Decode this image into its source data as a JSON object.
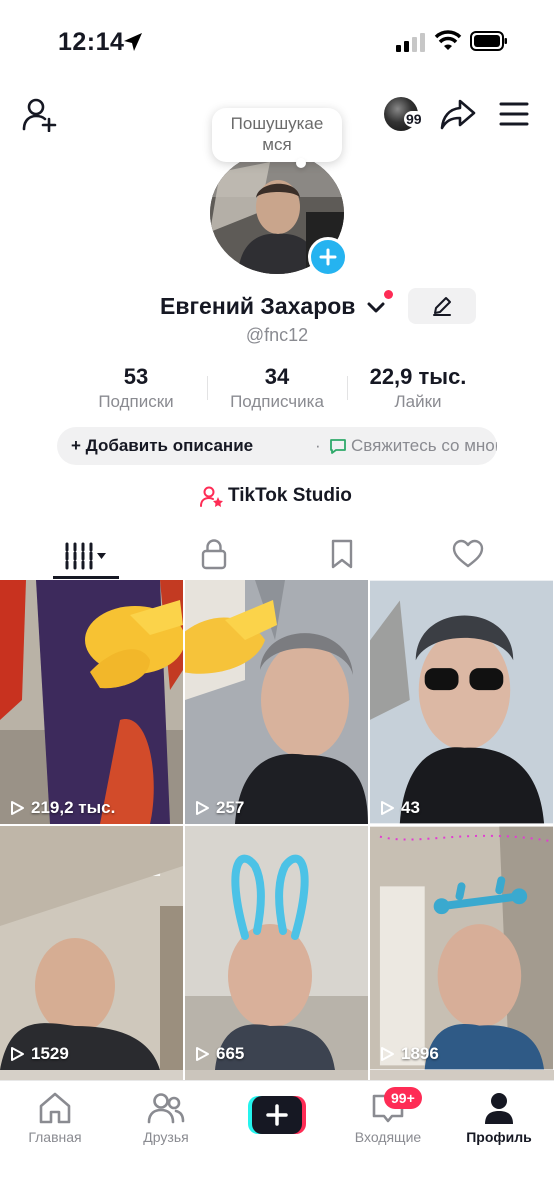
{
  "status_bar": {
    "time": "12:14"
  },
  "header": {
    "avatar_badge": "99",
    "icons": [
      "add-friend-icon",
      "share-icon",
      "menu-icon"
    ]
  },
  "profile": {
    "status_bubble": "Пошушукаемся",
    "status_bubble_line1": "Пошушукае",
    "status_bubble_line2": "мся",
    "display_name": "Евгений Захаров",
    "username": "@fnc12",
    "stats": [
      {
        "value": "53",
        "label": "Подписки"
      },
      {
        "value": "34",
        "label": "Подписчика"
      },
      {
        "value": "22,9 тыс.",
        "label": "Лайки"
      }
    ],
    "bio_add": "+ Добавить описание",
    "bio_separator": "·",
    "bio_contact": "Свяжитесь со мной…",
    "studio_label": "TikTok Studio"
  },
  "tabs": [
    "videos-tab",
    "private-tab",
    "saved-tab",
    "liked-tab"
  ],
  "videos": [
    {
      "views": "219,2 тыс."
    },
    {
      "views": "257"
    },
    {
      "views": "43"
    },
    {
      "views": "1529"
    },
    {
      "views": "665"
    },
    {
      "views": "1896"
    }
  ],
  "bottom_nav": {
    "home": "Главная",
    "friends": "Друзья",
    "inbox": "Входящие",
    "inbox_badge": "99+",
    "profile": "Профиль"
  },
  "colors": {
    "accent": "#fe2c55",
    "cyan": "#25f4ee",
    "text": "#161823",
    "muted": "#8a8b91"
  }
}
